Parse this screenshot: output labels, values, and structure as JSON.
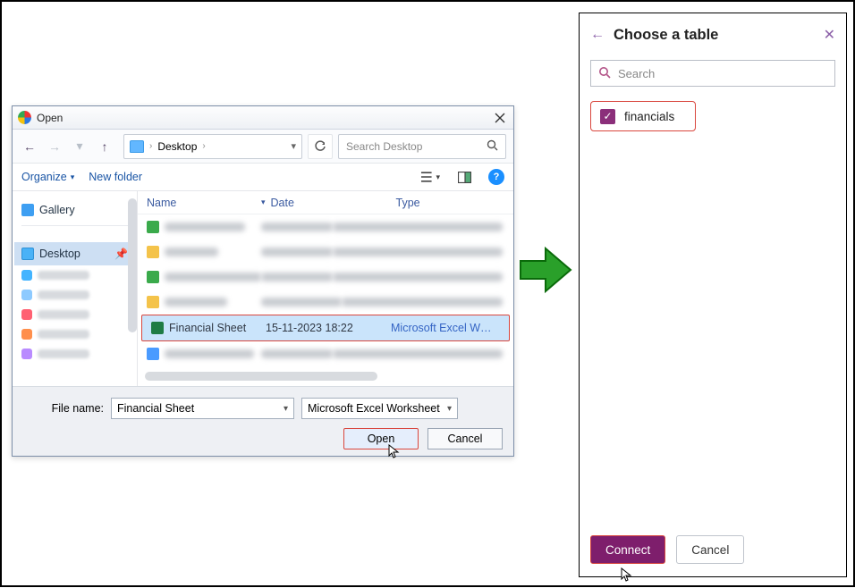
{
  "dialog": {
    "title": "Open",
    "breadcrumb": "Desktop",
    "search_placeholder": "Search Desktop",
    "organize": "Organize",
    "new_folder": "New folder",
    "help_glyph": "?"
  },
  "tree": {
    "gallery": "Gallery",
    "desktop": "Desktop"
  },
  "columns": {
    "name": "Name",
    "date": "Date",
    "type": "Type"
  },
  "selected_file": {
    "name": "Financial Sheet",
    "date": "15-11-2023 18:22",
    "type": "Microsoft Excel W…"
  },
  "footer": {
    "file_name_label": "File name:",
    "file_name_value": "Financial Sheet",
    "filter_value": "Microsoft Excel Worksheet",
    "open": "Open",
    "cancel": "Cancel"
  },
  "panel": {
    "title": "Choose a table",
    "search_placeholder": "Search",
    "table_name": "financials",
    "connect": "Connect",
    "cancel": "Cancel",
    "check_glyph": "✓"
  }
}
